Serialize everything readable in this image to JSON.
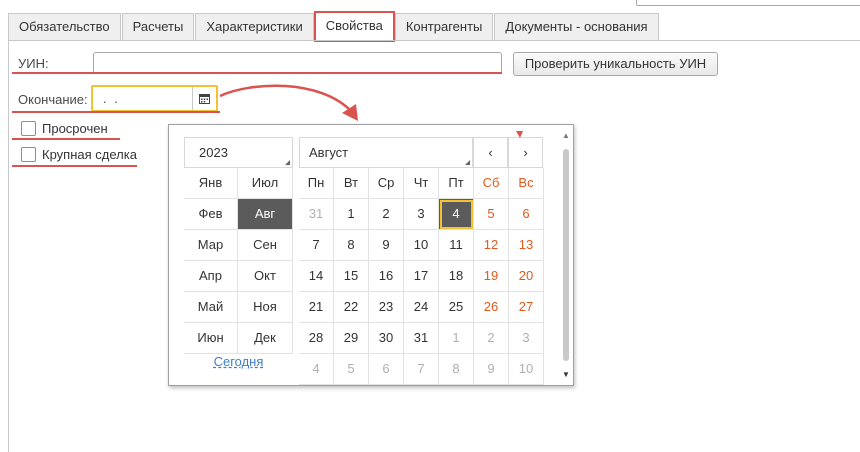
{
  "tabs": [
    {
      "label": "Обязательство"
    },
    {
      "label": "Расчеты"
    },
    {
      "label": "Характеристики"
    },
    {
      "label": "Свойства"
    },
    {
      "label": "Контрагенты"
    },
    {
      "label": "Документы - основания"
    }
  ],
  "active_tab": "Свойства",
  "form": {
    "uin_label": "УИН:",
    "uin_value": "",
    "check_button": "Проверить уникальность УИН",
    "end_label": "Окончание:",
    "end_value": ". .",
    "overdue_label": "Просрочен",
    "overdue_checked": false,
    "big_deal_label": "Крупная сделка",
    "big_deal_checked": false
  },
  "calendar": {
    "year": "2023",
    "month_name": "Август",
    "prev": "‹",
    "next": "›",
    "months": [
      "Янв",
      "Июл",
      "Фев",
      "Авг",
      "Мар",
      "Сен",
      "Апр",
      "Окт",
      "Май",
      "Ноя",
      "Июн",
      "Дек"
    ],
    "selected_month": "Авг",
    "today_label": "Сегодня",
    "weekdays": [
      "Пн",
      "Вт",
      "Ср",
      "Чт",
      "Пт",
      "Сб",
      "Вс"
    ],
    "days": [
      [
        "31",
        "1",
        "2",
        "3",
        "4",
        "5",
        "6"
      ],
      [
        "7",
        "8",
        "9",
        "10",
        "11",
        "12",
        "13"
      ],
      [
        "14",
        "15",
        "16",
        "17",
        "18",
        "19",
        "20"
      ],
      [
        "21",
        "22",
        "23",
        "24",
        "25",
        "26",
        "27"
      ],
      [
        "28",
        "29",
        "30",
        "31",
        "1",
        "2",
        "3"
      ],
      [
        "4",
        "5",
        "6",
        "7",
        "8",
        "9",
        "10"
      ]
    ],
    "selected_day": "4",
    "accent_color": "#e05a1e",
    "highlight_color": "#f2c230"
  },
  "annotation_color": "#d9534f"
}
